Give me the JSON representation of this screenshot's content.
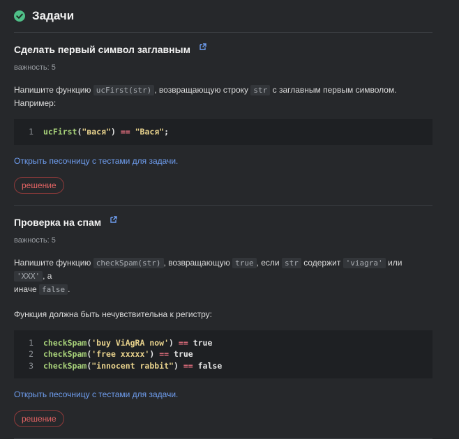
{
  "header": {
    "title": "Задачи"
  },
  "task1": {
    "title": "Сделать первый символ заглавным",
    "importance": "важность: 5",
    "desc_a": "Напишите функцию",
    "code1": "ucFirst(str)",
    "desc_b": ", возвращающую строку",
    "code2": "str",
    "desc_c": "с заглавным первым символом.",
    "desc_d": "Например:",
    "code": {
      "n1": "1",
      "fn": "ucFirst",
      "open": "(",
      "arg": "\"вася\"",
      "close": ")",
      "op": "==",
      "res": "\"Вася\"",
      "semi": ";"
    },
    "sandbox_link": "Открыть песочницу с тестами для задачи.",
    "solution_btn": "решение"
  },
  "task2": {
    "title": "Проверка на спам",
    "importance": "важность: 5",
    "desc_a": "Напишите функцию",
    "code1": "checkSpam(str)",
    "desc_b": ", возвращающую",
    "code2": "true",
    "desc_c": ", если",
    "code3": "str",
    "desc_d": "содержит",
    "code4": "'viagra'",
    "desc_e": "или",
    "code5": "'XXX'",
    "desc_f": ", а",
    "desc_g": "иначе",
    "code6": "false",
    "desc_h": ".",
    "desc2": "Функция должна быть нечувствительна к регистру:",
    "code": [
      {
        "n": "1",
        "fn": "checkSpam",
        "arg": "'buy ViAgRA now'",
        "op": "==",
        "res": "true"
      },
      {
        "n": "2",
        "fn": "checkSpam",
        "arg": "'free xxxxx'",
        "op": "==",
        "res": "true"
      },
      {
        "n": "3",
        "fn": "checkSpam",
        "arg": "\"innocent rabbit\"",
        "op": "==",
        "res": "false"
      }
    ],
    "sandbox_link": "Открыть песочницу с тестами для задачи.",
    "solution_btn": "решение"
  }
}
